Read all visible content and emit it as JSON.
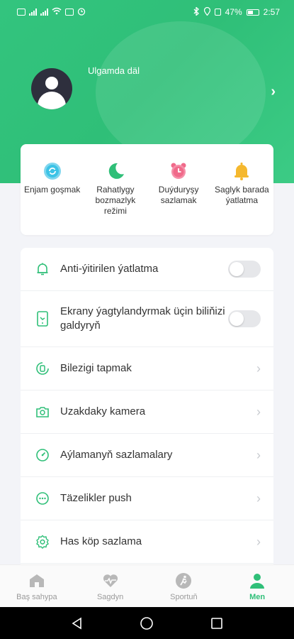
{
  "status_bar": {
    "battery": "47%",
    "time": "2:57"
  },
  "profile": {
    "name": "Ulgamda däl"
  },
  "quick_actions": [
    {
      "label": "Enjam goşmak",
      "icon": "refresh-circle-icon",
      "color": "#3cc3e6"
    },
    {
      "label": "Rahatlygy bozmazlyk režimi",
      "icon": "moon-icon",
      "color": "#2fbf78"
    },
    {
      "label": "Duýduryşy sazlamak",
      "icon": "alarm-clock-icon",
      "color": "#f06a8a"
    },
    {
      "label": "Saglyk barada ýatlatma",
      "icon": "bell-icon",
      "color": "#f5b82e"
    }
  ],
  "settings": [
    {
      "label": "Anti-ýitirilen ýatlatma",
      "icon": "bell-outline-icon",
      "type": "toggle",
      "on": false
    },
    {
      "label": "Ekrany ýagtylandyrmak üçin biliňizi galdyryň",
      "icon": "phone-wrist-icon",
      "type": "toggle",
      "on": false
    },
    {
      "label": "Bilezigi tapmak",
      "icon": "find-band-icon",
      "type": "link"
    },
    {
      "label": "Uzakdaky kamera",
      "icon": "camera-icon",
      "type": "link"
    },
    {
      "label": "Aýlamanyň sazlamalary",
      "icon": "dial-icon",
      "type": "link"
    },
    {
      "label": "Täzelikler push",
      "icon": "message-dots-icon",
      "type": "link"
    },
    {
      "label": "Has köp sazlama",
      "icon": "gear-icon",
      "type": "link"
    }
  ],
  "tabs": [
    {
      "label": "Baş sahypa",
      "icon": "home-icon",
      "active": false
    },
    {
      "label": "Sagdyn",
      "icon": "heart-pulse-icon",
      "active": false
    },
    {
      "label": "Sportuň",
      "icon": "running-icon",
      "active": false
    },
    {
      "label": "Men",
      "icon": "person-icon",
      "active": true
    }
  ],
  "colors": {
    "accent": "#2fbf78",
    "header": "#33c47e"
  }
}
